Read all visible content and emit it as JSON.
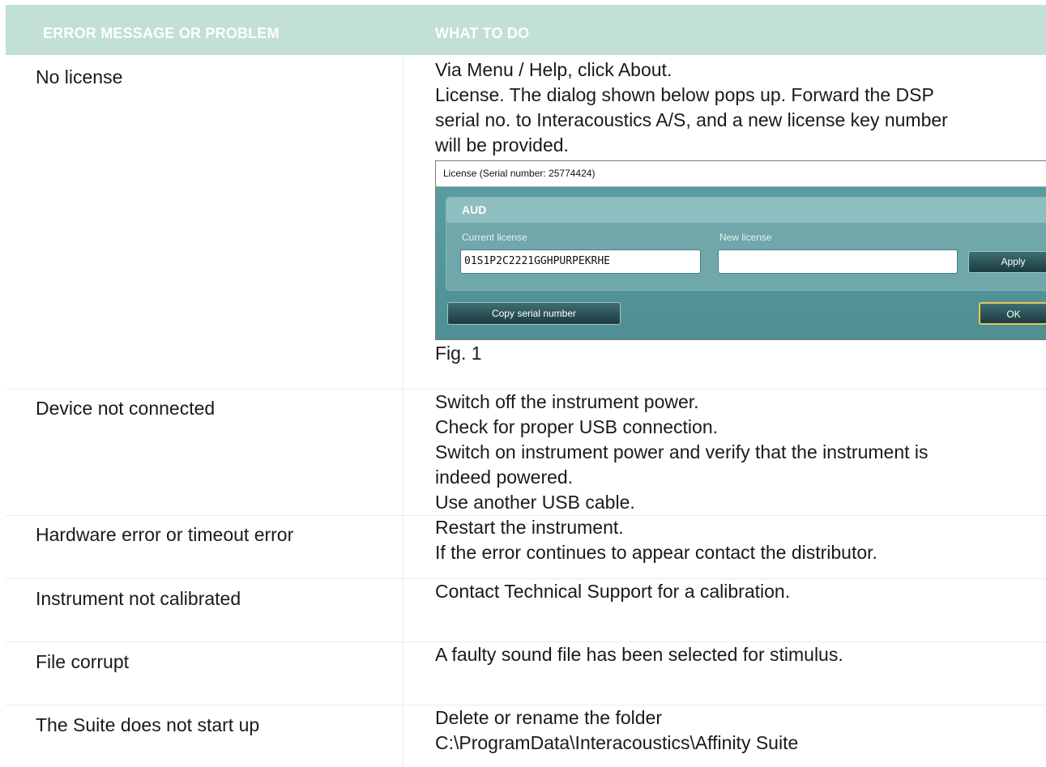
{
  "table": {
    "headers": [
      "ERROR MESSAGE OR PROBLEM",
      "WHAT TO DO"
    ],
    "rows": [
      {
        "problem": "No license",
        "todo": [
          "Via Menu / Help, click About.",
          "License. The dialog shown below pops up. Forward the DSP",
          "serial no. to Interacoustics A/S, and a new license key number",
          "will be provided."
        ],
        "figure_caption": "Fig. 1"
      },
      {
        "problem": "Device not connected",
        "todo": [
          "Switch off the instrument power.",
          "Check for proper USB connection.",
          "Switch on instrument power and verify that the instrument is",
          "indeed powered.",
          "Use another USB cable."
        ]
      },
      {
        "problem": "Hardware error or timeout error",
        "todo": [
          "Restart the instrument.",
          "If the error continues to appear contact the distributor."
        ]
      },
      {
        "problem": "Instrument not calibrated",
        "todo": [
          "Contact Technical Support for a calibration."
        ]
      },
      {
        "problem": "File corrupt",
        "todo": [
          "A faulty sound file has been selected for stimulus."
        ]
      },
      {
        "problem": "The Suite does not start up",
        "todo": [
          "Delete or rename the folder",
          "C:\\ProgramData\\Interacoustics\\Affinity Suite"
        ]
      }
    ]
  },
  "license_dialog": {
    "title": "License (Serial number: 25774424)",
    "group_title": "AUD",
    "current_license_label": "Current license",
    "current_license_value": "01S1P2C2221GGHPURPEKRHE",
    "new_license_label": "New license",
    "new_license_value": "",
    "apply_label": "Apply",
    "copy_serial_label": "Copy serial number",
    "ok_label": "OK"
  },
  "colors": {
    "header_background": "#c2e0d6",
    "dialog_background": "#5d9ea2",
    "ok_focus_border": "#e8c653"
  }
}
